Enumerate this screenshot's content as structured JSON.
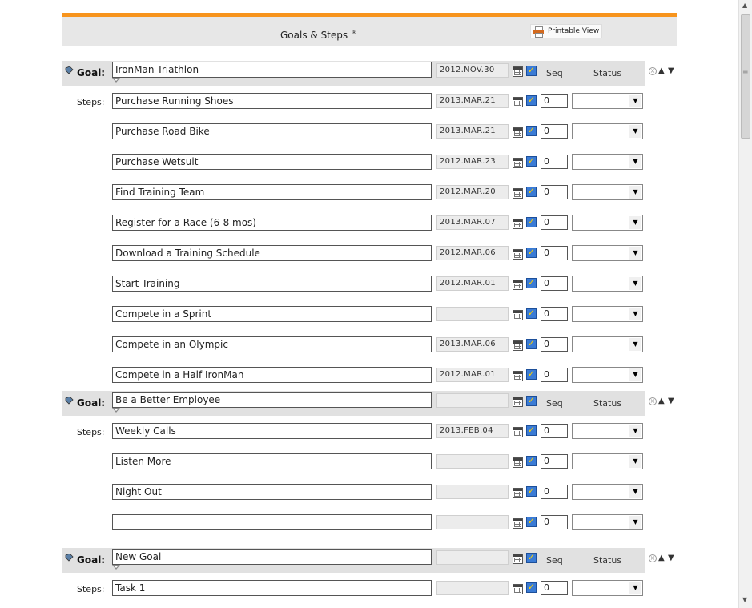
{
  "header": {
    "title": "Goals & Steps",
    "title_mark": "®",
    "print_label": "Printable View"
  },
  "labels": {
    "goal": "Goal:",
    "steps": "Steps:",
    "seq": "Seq",
    "status": "Status"
  },
  "goals": [
    {
      "name": "IronMan Triathlon",
      "date": "2012.NOV.30",
      "steps": [
        {
          "name": "Purchase Running Shoes",
          "date": "2013.MAR.21",
          "seq": "0",
          "status": ""
        },
        {
          "name": "Purchase Road Bike",
          "date": "2013.MAR.21",
          "seq": "0",
          "status": ""
        },
        {
          "name": "Purchase Wetsuit",
          "date": "2012.MAR.23",
          "seq": "0",
          "status": ""
        },
        {
          "name": "Find Training Team",
          "date": "2012.MAR.20",
          "seq": "0",
          "status": ""
        },
        {
          "name": "Register for a Race (6-8 mos)",
          "date": "2013.MAR.07",
          "seq": "0",
          "status": ""
        },
        {
          "name": "Download a Training Schedule",
          "date": "2012.MAR.06",
          "seq": "0",
          "status": ""
        },
        {
          "name": "Start Training",
          "date": "2012.MAR.01",
          "seq": "0",
          "status": ""
        },
        {
          "name": "Compete in a Sprint",
          "date": "",
          "seq": "0",
          "status": ""
        },
        {
          "name": "Compete in an Olympic",
          "date": "2013.MAR.06",
          "seq": "0",
          "status": ""
        },
        {
          "name": "Compete in a Half IronMan",
          "date": "2012.MAR.01",
          "seq": "0",
          "status": ""
        }
      ]
    },
    {
      "name": "Be a Better Employee",
      "date": "",
      "steps": [
        {
          "name": "Weekly Calls",
          "date": "2013.FEB.04",
          "seq": "0",
          "status": ""
        },
        {
          "name": "Listen More",
          "date": "",
          "seq": "0",
          "status": ""
        },
        {
          "name": "Night Out",
          "date": "",
          "seq": "0",
          "status": ""
        },
        {
          "name": "",
          "date": "",
          "seq": "0",
          "status": ""
        }
      ]
    },
    {
      "name": "New Goal",
      "date": "",
      "steps": [
        {
          "name": "Task 1",
          "date": "",
          "seq": "0",
          "status": ""
        }
      ]
    }
  ]
}
